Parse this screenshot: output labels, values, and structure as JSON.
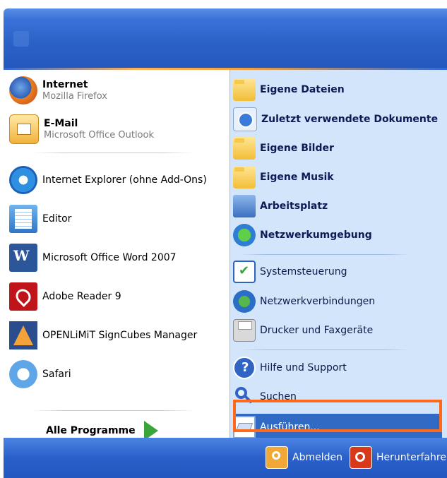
{
  "left": {
    "pinned": [
      {
        "title": "Internet",
        "subtitle": "Mozilla Firefox",
        "icon": "firefox-icon"
      },
      {
        "title": "E-Mail",
        "subtitle": "Microsoft Office Outlook",
        "icon": "outlook-icon"
      }
    ],
    "recent": [
      {
        "label": "Internet Explorer (ohne Add-Ons)",
        "icon": "internet-explorer-icon"
      },
      {
        "label": "Editor",
        "icon": "notepad-icon"
      },
      {
        "label": "Microsoft Office Word 2007",
        "icon": "word-icon"
      },
      {
        "label": "Adobe Reader 9",
        "icon": "adobe-reader-icon"
      },
      {
        "label": "OPENLiMiT SignCubes Manager",
        "icon": "openlimit-icon"
      },
      {
        "label": "Safari",
        "icon": "safari-icon"
      }
    ],
    "all_programs": "Alle Programme"
  },
  "right": {
    "items": [
      {
        "label": "Eigene Dateien",
        "icon": "folder-icon"
      },
      {
        "label": "Zuletzt verwendete Dokumente",
        "icon": "recent-documents-icon"
      },
      {
        "label": "Eigene Bilder",
        "icon": "pictures-folder-icon"
      },
      {
        "label": "Eigene Musik",
        "icon": "music-folder-icon"
      },
      {
        "label": "Arbeitsplatz",
        "icon": "computer-icon"
      },
      {
        "label": "Netzwerkumgebung",
        "icon": "network-icon"
      },
      {
        "label": "Systemsteuerung",
        "icon": "control-panel-icon"
      },
      {
        "label": "Netzwerkverbindungen",
        "icon": "network-connections-icon"
      },
      {
        "label": "Drucker und Faxgeräte",
        "icon": "printer-icon"
      },
      {
        "label": "Hilfe und Support",
        "icon": "help-icon"
      },
      {
        "label": "Suchen",
        "icon": "search-icon"
      },
      {
        "label": "Ausführen...",
        "icon": "run-icon"
      }
    ],
    "highlight_color": "#ff6a1a"
  },
  "footer": {
    "logoff": "Abmelden",
    "shutdown": "Herunterfahren"
  }
}
